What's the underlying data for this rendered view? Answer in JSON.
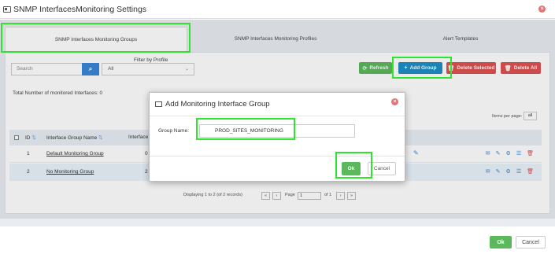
{
  "window": {
    "title": "SNMP InterfacesMonitoring Settings"
  },
  "tabs": [
    {
      "label": "SNMP Interfaces Monitoring Groups"
    },
    {
      "label": "SNMP Interfaces Monitoring Profiles"
    },
    {
      "label": "Alert Templates"
    }
  ],
  "filter": {
    "label": "Filter by Profile",
    "search_placeholder": "Search",
    "profile_selected": "All"
  },
  "toolbar": {
    "refresh": "Refresh",
    "add_group": "Add Group",
    "delete_selected": "Delete Selected",
    "delete_all": "Delete All"
  },
  "summary": {
    "total_label": "Total Number of monitored Interfaces: 0"
  },
  "items_per_page": {
    "label": "Items per page:",
    "value": "all"
  },
  "table": {
    "columns": [
      "ID",
      "Interface Group Name",
      "Interface"
    ],
    "rows": [
      {
        "id": "1",
        "name": "Default Monitoring Group",
        "interface": "0"
      },
      {
        "id": "2",
        "name": "No Monitoring Group",
        "interface": "2"
      }
    ]
  },
  "pagination": {
    "display_text": "Displaying 1 to 2 (of 2 records)",
    "page_label": "Page",
    "page_value": "1",
    "of_label": "of 1"
  },
  "dialog": {
    "title": "Add Monitoring Interface Group",
    "group_name_label": "Group Name:",
    "group_name_value": "PROD_SITES_MONITORING",
    "ok": "Ok",
    "cancel": "Cancel"
  },
  "footer": {
    "ok": "Ok",
    "cancel": "Cancel"
  },
  "colors": {
    "refresh_green": "#5cb85c",
    "add_blue": "#1f8fc6",
    "delete_red": "#e05252",
    "highlight": "#2ce52c"
  }
}
